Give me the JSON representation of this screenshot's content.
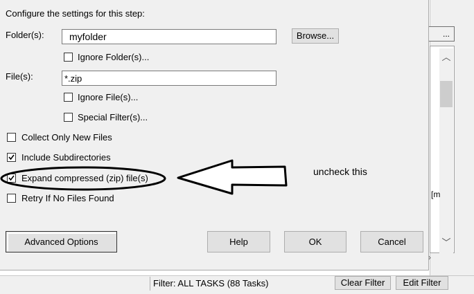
{
  "dialog": {
    "heading": "Configure the settings for this step:",
    "folder_label": "Folder(s):",
    "folder_value": "myfolder",
    "browse_label": "Browse...",
    "ignore_folders_label": "Ignore Folder(s)...",
    "file_label": "File(s):",
    "file_value": "*.zip",
    "ignore_files_label": "Ignore File(s)...",
    "special_filters_label": "Special Filter(s)...",
    "options": [
      {
        "label": "Collect Only New Files",
        "checked": false
      },
      {
        "label": "Include Subdirectories",
        "checked": true
      },
      {
        "label": "Expand compressed (zip) file(s)",
        "checked": true
      },
      {
        "label": "Retry If No Files Found",
        "checked": false
      }
    ],
    "advanced_label": "Advanced Options",
    "help_label": "Help",
    "ok_label": "OK",
    "cancel_label": "Cancel"
  },
  "background": {
    "button_fragment": "...",
    "text_fragment": "[m"
  },
  "statusbar": {
    "filter_text": "Filter: ALL TASKS (88 Tasks)",
    "clear_filter_label": "Clear Filter",
    "edit_filter_label": "Edit Filter"
  },
  "annotation": {
    "text": "uncheck this",
    "color": "#000000"
  }
}
